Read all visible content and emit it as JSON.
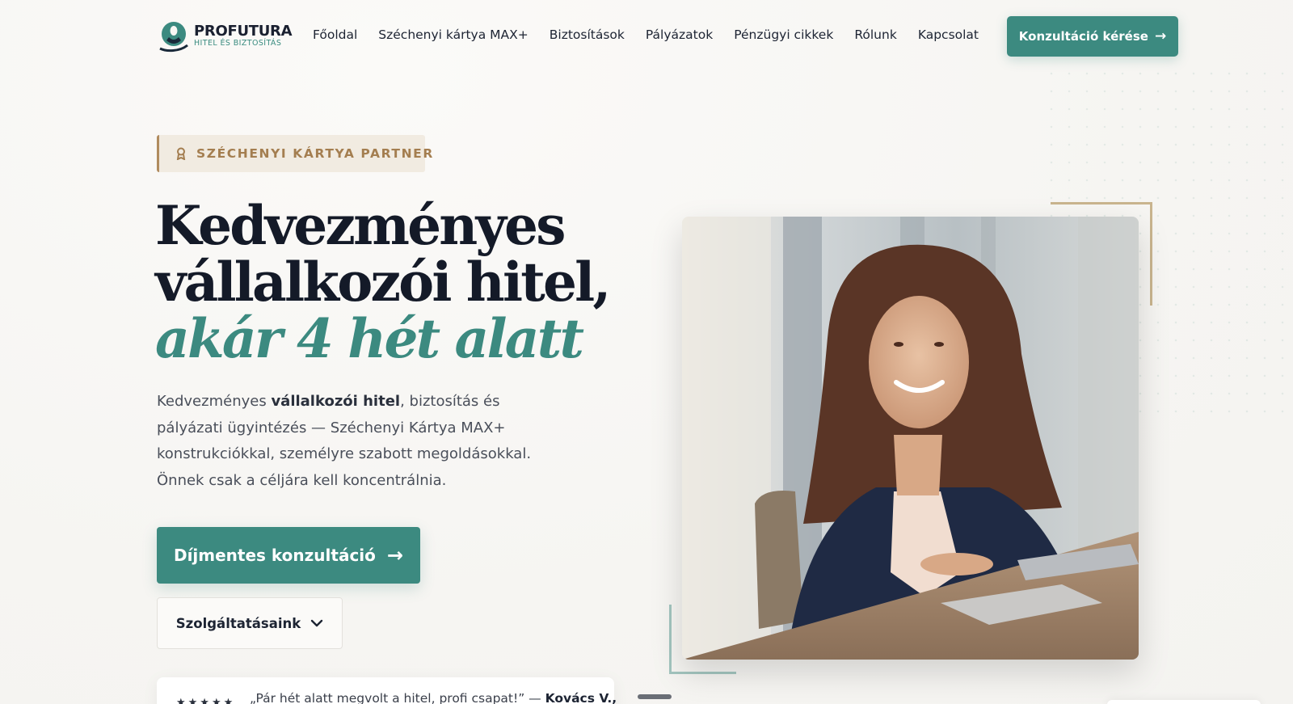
{
  "brand": {
    "name": "PROFUTURA",
    "tagline": "HITEL ÉS BIZTOSÍTÁS",
    "accent_color": "#3c8a80",
    "gold_color": "#b08b5e"
  },
  "nav": {
    "items": [
      {
        "label": "Főoldal"
      },
      {
        "label": "Széchenyi kártya MAX+"
      },
      {
        "label": "Biztosítások"
      },
      {
        "label": "Pályázatok"
      },
      {
        "label": "Pénzügyi cikkek"
      },
      {
        "label": "Rólunk"
      },
      {
        "label": "Kapcsolat"
      }
    ],
    "cta_label": "Konzultáció kérése",
    "cta_icon": "arrow-right-icon"
  },
  "hero": {
    "badge": {
      "icon": "award-icon",
      "label": "SZÉCHENYI KÁRTYA PARTNER"
    },
    "title_line1": "Kedvezményes",
    "title_line2": "vállalkozói hitel,",
    "title_accent": "akár 4 hét alatt",
    "lead_pre": "Kedvezményes ",
    "lead_bold": "vállalkozói hitel",
    "lead_post": ", biztosítás és pályázati ügyintézés — Széchenyi Kártya MAX+ konstrukciókkal, személyre szabott megoldásokkal. Önnek csak a céljára kell koncentrálnia.",
    "primary_button": "Díjmentes konzultáció",
    "secondary_button": "Szolgáltatásaink",
    "secondary_icon": "chevron-down-icon"
  },
  "testimonial": {
    "stars": "★★★★★",
    "quote": "„Pár hét alatt megvolt a hitel, profi csapat!” — ",
    "author": "Kovács V.,"
  },
  "photo": {
    "subject": "portrait-photo"
  }
}
